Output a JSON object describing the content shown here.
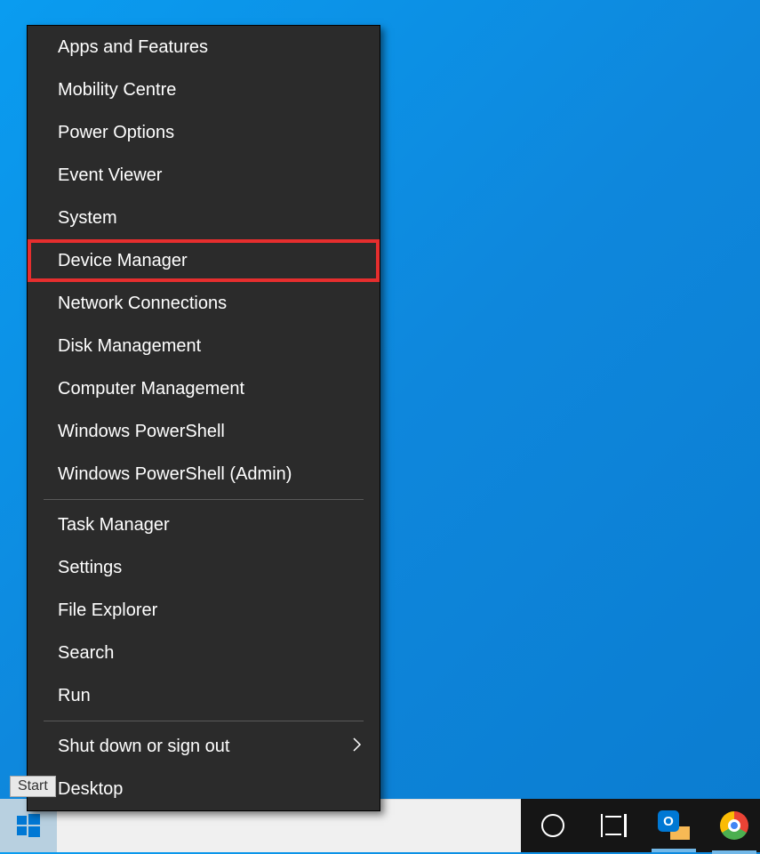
{
  "menu": {
    "section1": [
      {
        "label": "Apps and Features",
        "highlighted": false,
        "submenu": false
      },
      {
        "label": "Mobility Centre",
        "highlighted": false,
        "submenu": false
      },
      {
        "label": "Power Options",
        "highlighted": false,
        "submenu": false
      },
      {
        "label": "Event Viewer",
        "highlighted": false,
        "submenu": false
      },
      {
        "label": "System",
        "highlighted": false,
        "submenu": false
      },
      {
        "label": "Device Manager",
        "highlighted": true,
        "submenu": false
      },
      {
        "label": "Network Connections",
        "highlighted": false,
        "submenu": false
      },
      {
        "label": "Disk Management",
        "highlighted": false,
        "submenu": false
      },
      {
        "label": "Computer Management",
        "highlighted": false,
        "submenu": false
      },
      {
        "label": "Windows PowerShell",
        "highlighted": false,
        "submenu": false
      },
      {
        "label": "Windows PowerShell (Admin)",
        "highlighted": false,
        "submenu": false
      }
    ],
    "section2": [
      {
        "label": "Task Manager",
        "highlighted": false,
        "submenu": false
      },
      {
        "label": "Settings",
        "highlighted": false,
        "submenu": false
      },
      {
        "label": "File Explorer",
        "highlighted": false,
        "submenu": false
      },
      {
        "label": "Search",
        "highlighted": false,
        "submenu": false
      },
      {
        "label": "Run",
        "highlighted": false,
        "submenu": false
      }
    ],
    "section3": [
      {
        "label": "Shut down or sign out",
        "highlighted": false,
        "submenu": true
      },
      {
        "label": "Desktop",
        "highlighted": false,
        "submenu": false
      }
    ]
  },
  "tooltip": {
    "start": "Start"
  },
  "taskbar": {
    "apps": [
      "outlook",
      "chrome"
    ]
  }
}
